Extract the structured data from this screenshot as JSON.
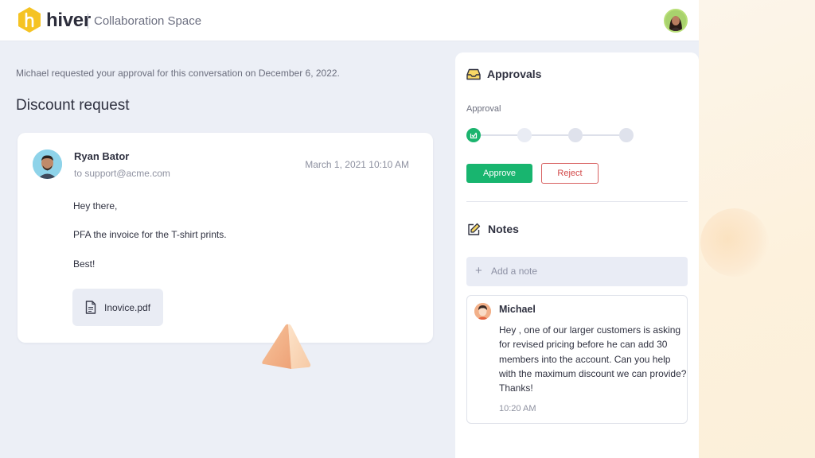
{
  "header": {
    "logo_text": "hiver",
    "space_title": "Collaboration Space",
    "user_avatar": "user-avatar"
  },
  "main": {
    "approval_message": "Michael requested your approval for this conversation on December 6, 2022.",
    "title": "Discount request",
    "email": {
      "sender_name": "Ryan Bator",
      "to": "to support@acme.com",
      "date": "March 1, 2021 10:10 AM",
      "lines": [
        "Hey there,",
        "PFA the invoice for the T-shirt prints.",
        "Best!"
      ],
      "attachment": {
        "name": "Inovice.pdf",
        "icon": "document-icon"
      }
    }
  },
  "panel": {
    "approvals": {
      "title": "Approvals",
      "icon": "inbox-icon",
      "label": "Approval",
      "steps": [
        "done",
        "pending",
        "pending",
        "pending"
      ],
      "approve_label": "Approve",
      "reject_label": "Reject"
    },
    "notes": {
      "title": "Notes",
      "icon": "edit-note-icon",
      "add_placeholder": "Add a note",
      "items": [
        {
          "author": "Michael",
          "body": "Hey , one of our larger customers is asking for revised pricing before he can add 30 members into the account. Can you help with the maximum discount we can provide? Thanks!",
          "time": "10:20 AM"
        }
      ]
    }
  },
  "colors": {
    "brand_yellow": "#f5c323",
    "approve_green": "#18b56f",
    "reject_red": "#d24848",
    "background": "#eceff6"
  }
}
